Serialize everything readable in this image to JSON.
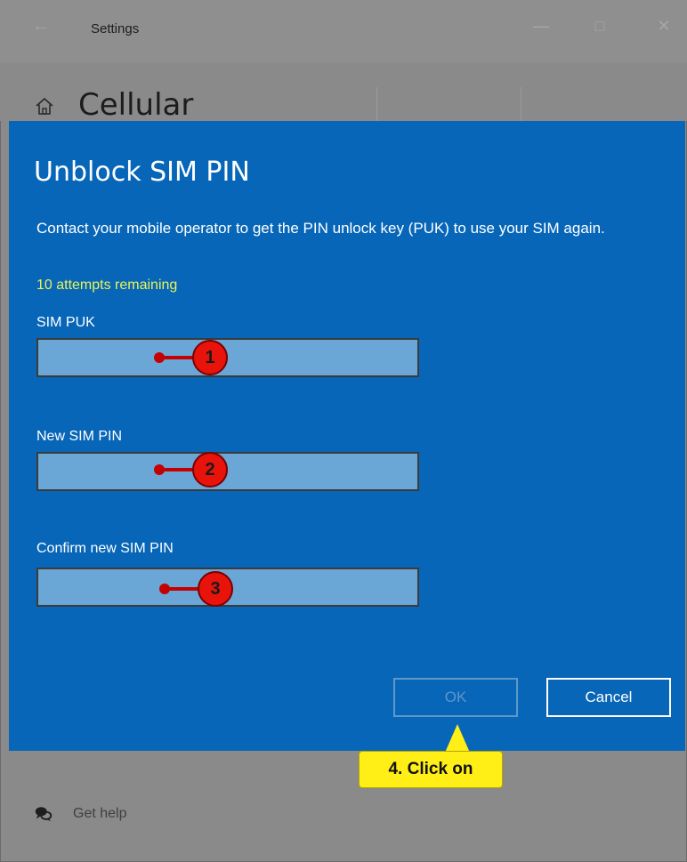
{
  "window": {
    "title": "Settings",
    "back_icon": "back-arrow-icon",
    "controls": [
      "minimize-icon",
      "maximize-icon",
      "close-icon"
    ]
  },
  "page": {
    "title": "Cellular",
    "home_icon": "home-icon"
  },
  "dialog": {
    "title": "Unblock SIM PIN",
    "description": "Contact your mobile operator to get the PIN unlock key (PUK) to use your SIM again.",
    "attempts": "10 attempts remaining",
    "fields": [
      {
        "label": "SIM PUK",
        "value": "",
        "step": "1"
      },
      {
        "label": "New SIM PIN",
        "value": "",
        "step": "2"
      },
      {
        "label": "Confirm new SIM PIN",
        "value": "",
        "step": "3"
      }
    ],
    "ok_label": "OK",
    "cancel_label": "Cancel"
  },
  "annotation": {
    "tooltip": "4. Click on"
  },
  "footer": {
    "get_help": "Get help"
  },
  "colors": {
    "dialog_bg": "#0766b8",
    "attempts": "#e8f25a",
    "field_bg": "#6aa6d6",
    "callout_red": "#e8140c",
    "tooltip_yellow": "#ffef16"
  }
}
